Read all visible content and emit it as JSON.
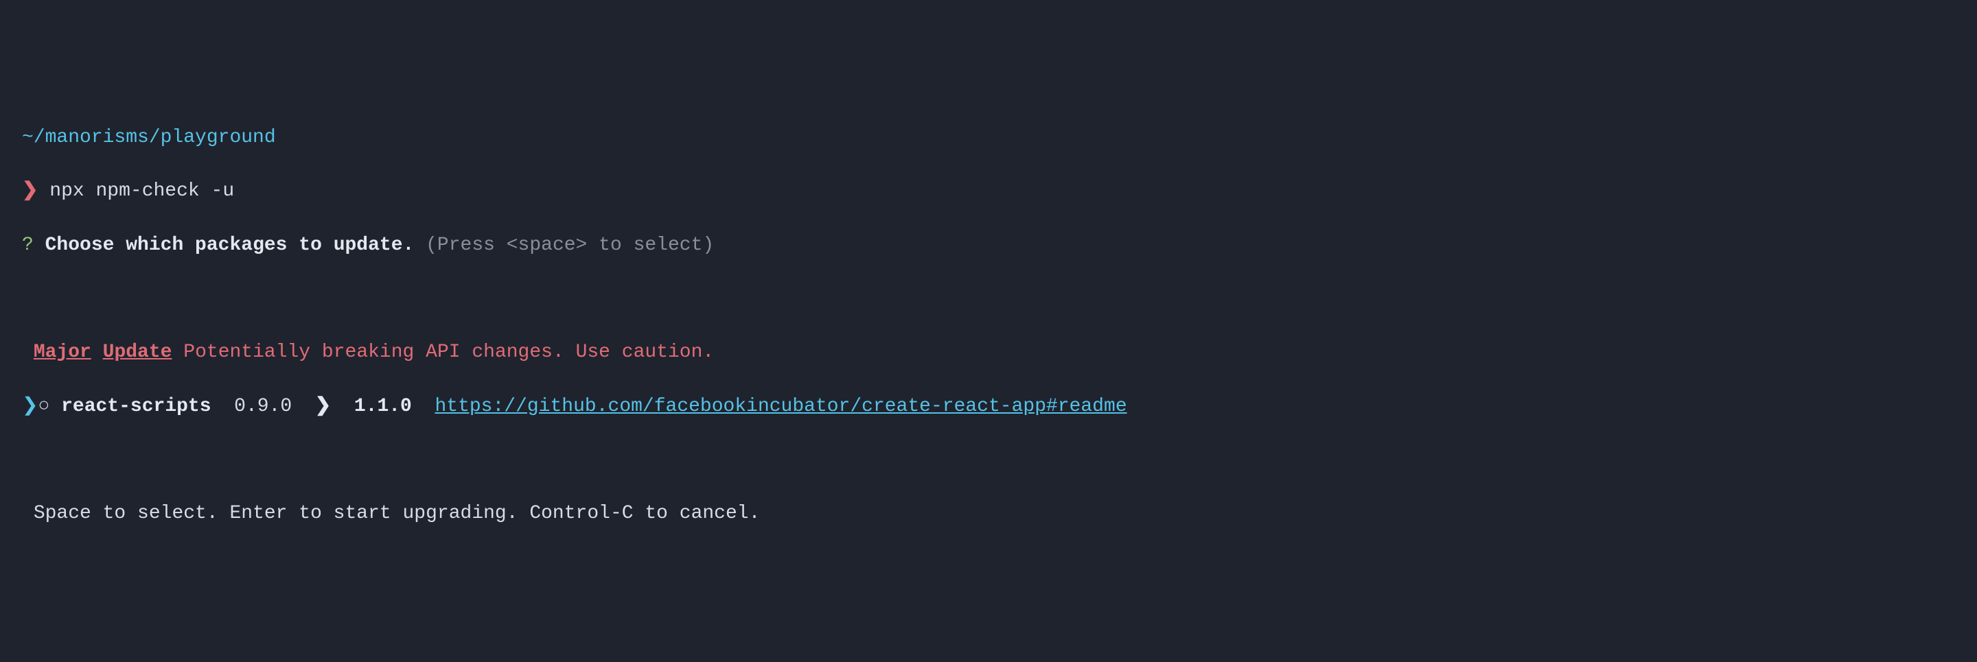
{
  "cwd": "~/manorisms/playground",
  "prompt_symbol": "❯",
  "command": "npx npm-check -u",
  "question_symbol": "?",
  "choose_label": "Choose which packages to update.",
  "choose_hint": "(Press <space> to select)",
  "section": {
    "major": "Major",
    "update": "Update",
    "warning": "Potentially breaking API changes. Use caution."
  },
  "cursor": "❯",
  "radio": "○",
  "pkg": {
    "name": "react-scripts",
    "from": "0.9.0",
    "arrow": "❯",
    "to": "1.1.0",
    "url": "https://github.com/facebookincubator/create-react-app#readme"
  },
  "hint": "Space to select. Enter to start upgrading. Control-C to cancel."
}
